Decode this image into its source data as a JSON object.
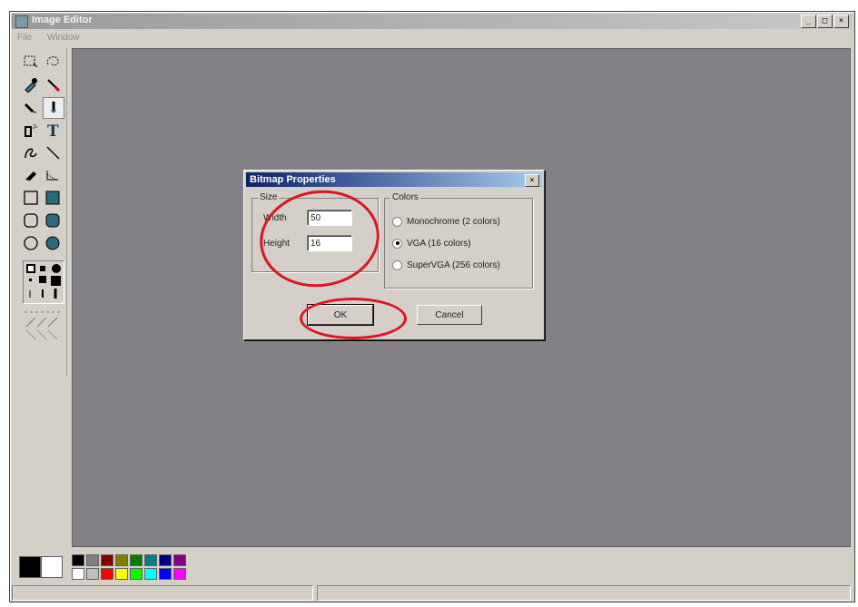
{
  "window": {
    "title": "Image Editor",
    "controls": [
      "_",
      "□",
      "×"
    ]
  },
  "menu": [
    "File",
    "Window"
  ],
  "toolbox": {
    "tools": [
      "rect-select-icon",
      "lasso-select-icon",
      "color-picker-icon",
      "fill-bucket-icon",
      "pencil-icon",
      "brush-icon",
      "airbrush-icon",
      "text-icon",
      "curve-icon",
      "line-icon",
      "eraser-icon",
      "angle-line-icon",
      "rectangle-icon",
      "filled-rectangle-icon",
      "rounded-rect-icon",
      "filled-rounded-rect-icon",
      "ellipse-icon",
      "filled-ellipse-icon"
    ]
  },
  "palette": {
    "current_fg": "#000000",
    "current_bg": "#ffffff",
    "row1": [
      "#000000",
      "#808080",
      "#800000",
      "#808000",
      "#008000",
      "#008080",
      "#000080",
      "#800080"
    ],
    "row2": [
      "#ffffff",
      "#c0c0c0",
      "#ff0000",
      "#ffff00",
      "#00ff00",
      "#00ffff",
      "#0000ff",
      "#ff00ff"
    ]
  },
  "dialog": {
    "title": "Bitmap Properties",
    "close": "×",
    "size_group": "Size",
    "width_label": "Width",
    "width_value": "50",
    "height_label": "Height",
    "height_value": "16",
    "colors_group": "Colors",
    "options": [
      {
        "label": "Monochrome (2 colors)",
        "selected": false
      },
      {
        "label": "VGA (16 colors)",
        "selected": true
      },
      {
        "label": "SuperVGA (256 colors)",
        "selected": false
      }
    ],
    "ok_label": "OK",
    "cancel_label": "Cancel"
  },
  "colors": {
    "workspace": "#838185",
    "annotation": "#e0141e"
  }
}
